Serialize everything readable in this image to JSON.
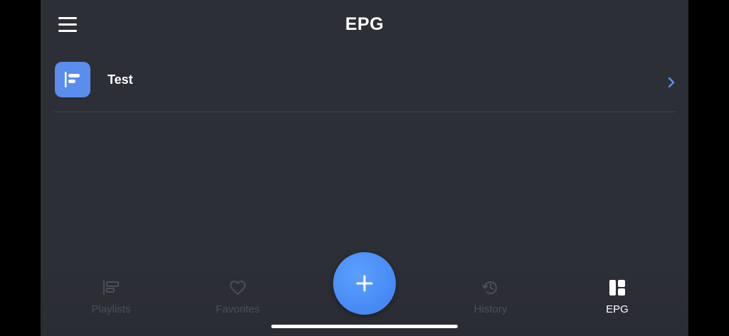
{
  "header": {
    "title": "EPG",
    "menu_icon": "hamburger-menu-icon"
  },
  "list": {
    "items": [
      {
        "label": "Test",
        "icon": "epg-list-icon",
        "chevron": "chevron-right-icon"
      }
    ]
  },
  "tabbar": {
    "tabs": [
      {
        "label": "Playlists",
        "icon": "playlists-icon",
        "active": false
      },
      {
        "label": "Favorites",
        "icon": "heart-icon",
        "active": false
      },
      {
        "label": "History",
        "icon": "history-icon",
        "active": false
      },
      {
        "label": "EPG",
        "icon": "epg-grid-icon",
        "active": true
      }
    ],
    "fab_icon": "plus-icon"
  },
  "colors": {
    "background": "#2d2f36",
    "accent": "#5b8def",
    "inactive_tab": "#4b4f5a",
    "active_tab": "#ffffff"
  }
}
